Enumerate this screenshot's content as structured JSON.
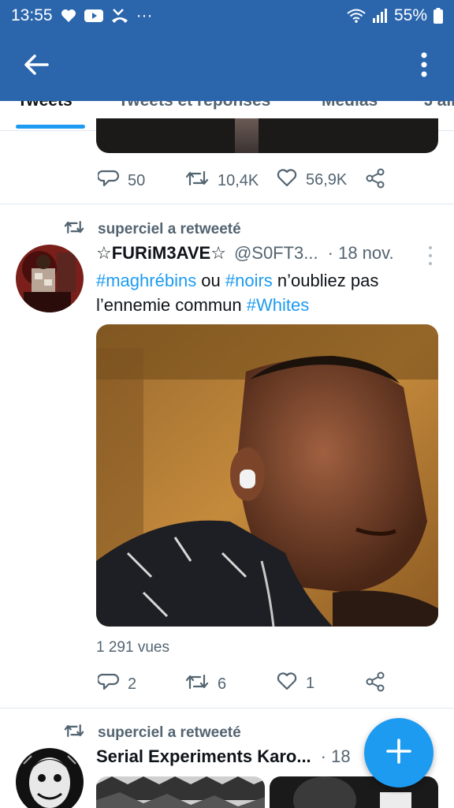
{
  "status_bar": {
    "time": "13:55",
    "more_dots": "···",
    "battery": "55%"
  },
  "tabs": [
    {
      "label": "Tweets"
    },
    {
      "label": "Tweets et réponses"
    },
    {
      "label": "Médias"
    },
    {
      "label": "J'aime"
    }
  ],
  "previous_tweet": {
    "replies": "50",
    "retweets": "10,4K",
    "likes": "56,9K"
  },
  "tweet": {
    "retweet_label": "superciel a retweeté",
    "name": "☆FURiM3AVE☆",
    "handle": "@S0FT3...",
    "date": "· 18 nov.",
    "text_parts": {
      "h1": "#maghrébins",
      "t1": " ou ",
      "h2": "#noirs",
      "t2": " n’oubliez pas l’ennemie commun ",
      "h3": "#Whites"
    },
    "views": "1 291 vues",
    "replies": "2",
    "retweets": "6",
    "likes": "1"
  },
  "next_tweet": {
    "retweet_label": "superciel a retweeté",
    "name": "Serial Experiments Karo...",
    "date": "· 18"
  },
  "colors": {
    "app_bar": "#2b66ad",
    "accent": "#1d9bf0",
    "secondary_text": "#536471"
  },
  "icons": [
    "heart-icon",
    "youtube-icon",
    "missed-call-icon",
    "wifi-icon",
    "signal-icon",
    "battery-icon",
    "back-arrow-icon",
    "overflow-menu-icon",
    "reply-icon",
    "retweet-icon",
    "like-icon",
    "share-icon",
    "caret-menu-icon",
    "plus-icon"
  ]
}
